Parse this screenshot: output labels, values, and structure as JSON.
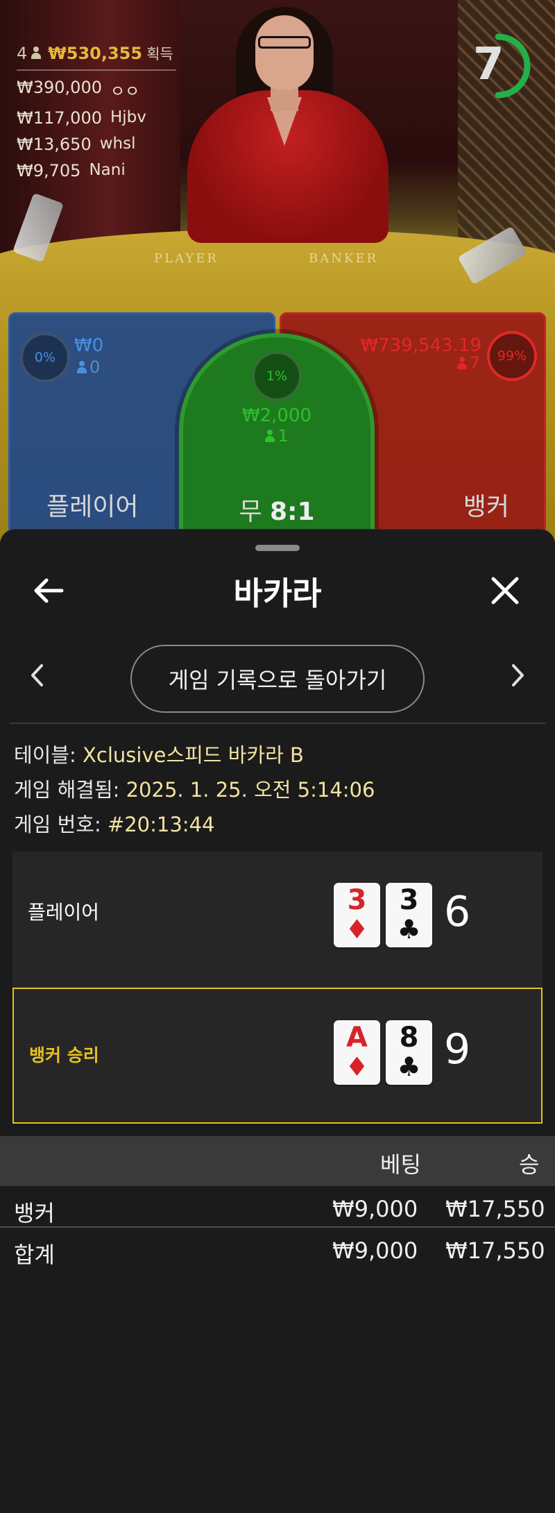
{
  "leaderboard": {
    "count": "4",
    "amount": "₩530,355",
    "label": "획득",
    "rows": [
      {
        "amount": "₩390,000",
        "name": "ㅇㅇ"
      },
      {
        "amount": "₩117,000",
        "name": "Hjbv"
      },
      {
        "amount": "₩13,650",
        "name": "whsl"
      },
      {
        "amount": "₩9,705",
        "name": "Nani"
      }
    ]
  },
  "timer": {
    "value": "7",
    "fraction": 0.5,
    "color": "#22b04a"
  },
  "table_labels": {
    "player": "PLAYER",
    "banker": "BANKER"
  },
  "bet_zones": {
    "player": {
      "pct": "0%",
      "amount": "₩0",
      "players": "0",
      "label": "플레이어",
      "color": "#4a90e0"
    },
    "tie": {
      "pct": "1%",
      "amount": "₩2,000",
      "players": "1",
      "label": "무",
      "odds": "8:1",
      "color": "#2ec02e"
    },
    "banker": {
      "pct": "99%",
      "amount": "₩739,543.19",
      "players": "7",
      "label": "뱅커",
      "color": "#e02828"
    }
  },
  "sheet": {
    "title": "바카라",
    "back_to_history": "게임 기록으로 돌아가기",
    "table_label": "테이블:",
    "table_value": "Xclusive스피드 바카라 B",
    "resolved_label": "게임 해결됨:",
    "resolved_value": "2025. 1. 25. 오전 5:14:06",
    "game_no_label": "게임 번호:",
    "game_no_value": "#20:13:44",
    "player_result": {
      "label": "플레이어",
      "cards": [
        {
          "rank": "3",
          "suit": "♦"
        },
        {
          "rank": "3",
          "suit": "♣"
        }
      ],
      "score": "6"
    },
    "banker_result": {
      "label": "뱅커 승리",
      "cards": [
        {
          "rank": "A",
          "suit": "♦"
        },
        {
          "rank": "8",
          "suit": "♣"
        }
      ],
      "score": "9"
    },
    "bets_table": {
      "headers": {
        "bet": "베팅",
        "win": "승"
      },
      "rows": [
        {
          "name": "뱅커",
          "bet": "₩9,000",
          "win": "₩17,550"
        },
        {
          "name": "합계",
          "bet": "₩9,000",
          "win": "₩17,550"
        }
      ]
    },
    "accent_color": "#e4c21e"
  }
}
